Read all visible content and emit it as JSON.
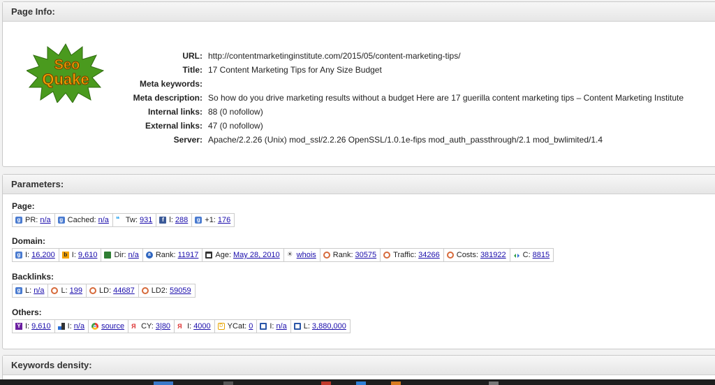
{
  "page_info": {
    "title": "Page Info:",
    "rows": [
      {
        "label": "URL:",
        "value": "http://contentmarketinginstitute.com/2015/05/content-marketing-tips/"
      },
      {
        "label": "Title:",
        "value": "17 Content Marketing Tips for Any Size Budget"
      },
      {
        "label": "Meta keywords:",
        "value": ""
      },
      {
        "label": "Meta description:",
        "value": "So how do you drive marketing results without a budget Here are 17 guerilla content marketing tips – Content Marketing Institute"
      },
      {
        "label": "Internal links:",
        "value": "88 (0 nofollow)"
      },
      {
        "label": "External links:",
        "value": "47 (0 nofollow)"
      },
      {
        "label": "Server:",
        "value": "Apache/2.2.26 (Unix) mod_ssl/2.2.26 OpenSSL/1.0.1e-fips mod_auth_passthrough/2.1 mod_bwlimited/1.4"
      }
    ],
    "logo": {
      "line1": "Seo",
      "line2": "Quake"
    }
  },
  "parameters": {
    "title": "Parameters:",
    "groups": [
      {
        "title": "Page:",
        "items": [
          {
            "icon": "google-icon",
            "label": "PR:",
            "value": "n/a"
          },
          {
            "icon": "google-icon",
            "label": "Cached:",
            "value": "n/a"
          },
          {
            "icon": "twitter-icon",
            "label": "Tw:",
            "value": "931"
          },
          {
            "icon": "facebook-icon",
            "label": "l:",
            "value": "288"
          },
          {
            "icon": "google-icon",
            "label": "+1:",
            "value": "176"
          }
        ]
      },
      {
        "title": "Domain:",
        "items": [
          {
            "icon": "google-icon",
            "label": "I:",
            "value": "16,200"
          },
          {
            "icon": "bing-icon",
            "label": "I:",
            "value": "9,610"
          },
          {
            "icon": "dmoz-icon",
            "label": "Dir:",
            "value": "n/a"
          },
          {
            "icon": "alexa-icon",
            "label": "Rank:",
            "value": "11917"
          },
          {
            "icon": "calendar-icon",
            "label": "Age:",
            "value": "May 28, 2010"
          },
          {
            "icon": "whois-icon",
            "label": "",
            "value": "whois"
          },
          {
            "icon": "semrush-icon",
            "label": "Rank:",
            "value": "30575"
          },
          {
            "icon": "semrush-icon",
            "label": "Traffic:",
            "value": "34266"
          },
          {
            "icon": "semrush-icon",
            "label": "Costs:",
            "value": "381922"
          },
          {
            "icon": "compete-icon",
            "label": "C:",
            "value": "8815"
          }
        ]
      },
      {
        "title": "Backlinks:",
        "items": [
          {
            "icon": "google-icon",
            "label": "L:",
            "value": "n/a"
          },
          {
            "icon": "semrush-icon",
            "label": "L:",
            "value": "199"
          },
          {
            "icon": "semrush-icon",
            "label": "LD:",
            "value": "44687"
          },
          {
            "icon": "semrush-icon",
            "label": "LD2:",
            "value": "59059"
          }
        ]
      },
      {
        "title": "Others:",
        "items": [
          {
            "icon": "yahoo-icon",
            "label": "I:",
            "value": "9,610"
          },
          {
            "icon": "squares-icon",
            "label": "I:",
            "value": "n/a"
          },
          {
            "icon": "chrome-icon",
            "label": "",
            "value": "source"
          },
          {
            "icon": "yandex-icon",
            "label": "CY:",
            "value": "3|80"
          },
          {
            "icon": "yandex-icon",
            "label": "I:",
            "value": "4000"
          },
          {
            "icon": "yandex-catalog-icon",
            "label": "YCat:",
            "value": "0"
          },
          {
            "icon": "alexa-box-icon",
            "label": "I:",
            "value": "n/a"
          },
          {
            "icon": "alexa-box-icon",
            "label": "L:",
            "value": "3,880,000"
          }
        ]
      }
    ]
  },
  "keywords": {
    "title": "Keywords density:"
  }
}
